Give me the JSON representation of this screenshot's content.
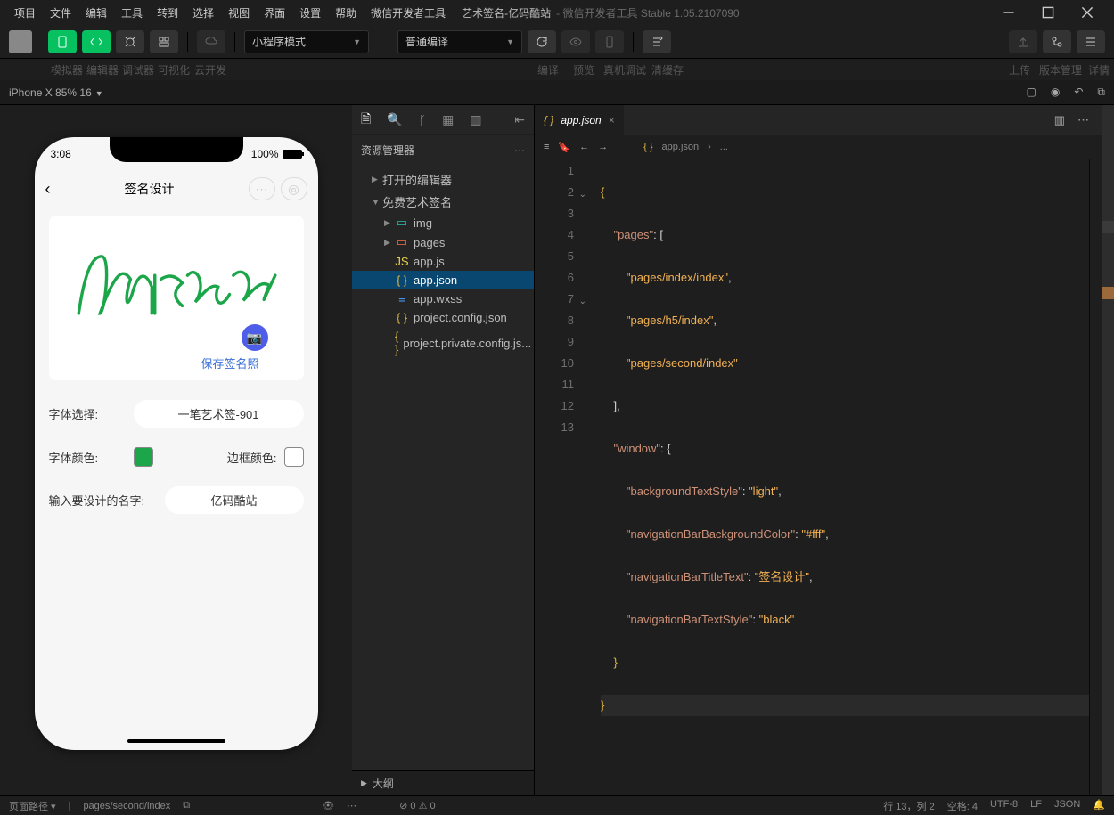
{
  "menu": [
    "项目",
    "文件",
    "编辑",
    "工具",
    "转到",
    "选择",
    "视图",
    "界面",
    "设置",
    "帮助",
    "微信开发者工具"
  ],
  "title": "艺术签名-亿码酷站",
  "subtitle": "- 微信开发者工具 Stable 1.05.2107090",
  "sublabels": {
    "sim": "模拟器",
    "editor": "编辑器",
    "debug": "调试器",
    "vis": "可视化",
    "cloud": "云开发",
    "compile": "编译",
    "preview": "预览",
    "realdebug": "真机调试",
    "clearcache": "清缓存",
    "upload": "上传",
    "version": "版本管理",
    "detail": "详情"
  },
  "dropdown1": "小程序模式",
  "dropdown2": "普通编译",
  "device": {
    "name": "iPhone X 85% 16",
    "time": "3:08",
    "battery": "100%"
  },
  "preview": {
    "title": "签名设计",
    "saveLink": "保存签名照",
    "fontLabel": "字体选择:",
    "fontValue": "一笔艺术签-901",
    "colorLabel": "字体颜色:",
    "borderLabel": "边框颜色:",
    "nameLabel": "输入要设计的名字:",
    "nameValue": "亿码酷站"
  },
  "explorer": {
    "header": "资源管理器",
    "openEditors": "打开的编辑器",
    "project": "免费艺术签名",
    "items": {
      "img": "img",
      "pages": "pages",
      "appjs": "app.js",
      "appjson": "app.json",
      "appwxss": "app.wxss",
      "pcj": "project.config.json",
      "ppcj": "project.private.config.js..."
    }
  },
  "outline": "大纲",
  "tab": {
    "file": "app.json"
  },
  "crumb": {
    "file": "app.json",
    "more": "..."
  },
  "code": {
    "lines": [
      "1",
      "2",
      "3",
      "4",
      "5",
      "6",
      "7",
      "8",
      "9",
      "10",
      "11",
      "12",
      "13"
    ],
    "l1": "{",
    "l2_k": "\"pages\"",
    "l2_r": ": [",
    "l3": "\"pages/index/index\"",
    "l4": "\"pages/h5/index\"",
    "l5": "\"pages/second/index\"",
    "l6": "],",
    "l7_k": "\"window\"",
    "l7_r": ": {",
    "l8_k": "\"backgroundTextStyle\"",
    "l8_v": "\"light\"",
    "l9_k": "\"navigationBarBackgroundColor\"",
    "l9_v": "\"#fff\"",
    "l10_k": "\"navigationBarTitleText\"",
    "l10_v": "\"签名设计\"",
    "l11_k": "\"navigationBarTextStyle\"",
    "l11_v": "\"black\"",
    "l12": "}",
    "l13": "}"
  },
  "status": {
    "pagepath": "页面路径",
    "path": "pages/second/index",
    "err": "0",
    "warn": "0",
    "ln": "行 13，列 2",
    "space": "空格: 4",
    "enc": "UTF-8",
    "eol": "LF",
    "lang": "JSON"
  }
}
